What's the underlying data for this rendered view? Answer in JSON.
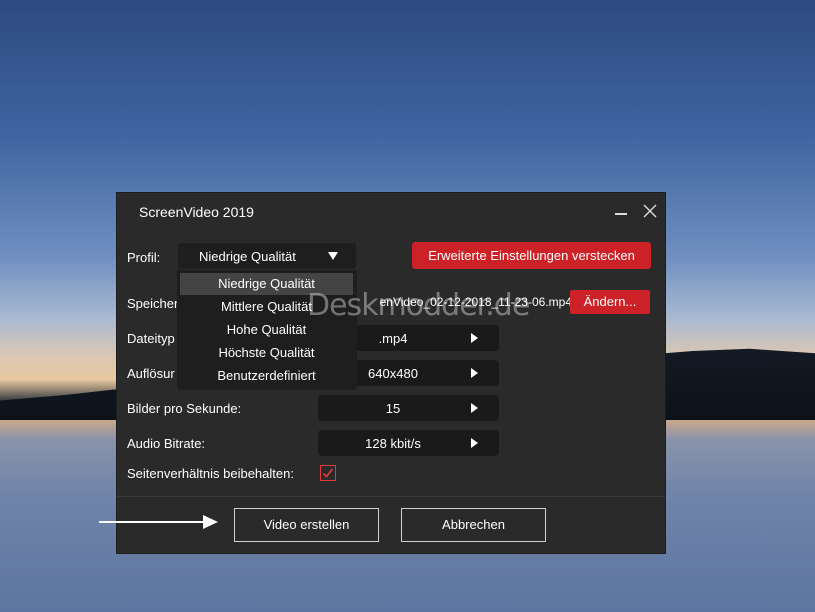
{
  "window": {
    "title": "ScreenVideo 2019"
  },
  "profile": {
    "label": "Profil:",
    "value": "Niedrige Qualität"
  },
  "advanced_button": "Erweiterte Einstellungen verstecken",
  "save": {
    "label": "Speicher",
    "path": "enVideo_02-12-2018_11-23-06.mp4",
    "change_button": "Ändern..."
  },
  "filetype": {
    "label": "Dateityp",
    "value": ".mp4"
  },
  "resolution": {
    "label": "Auflösur",
    "value": "640x480"
  },
  "fps": {
    "label": "Bilder pro Sekunde:",
    "value": "15"
  },
  "audio": {
    "label": "Audio Bitrate:",
    "value": "128 kbit/s"
  },
  "aspect": {
    "label": "Seitenverhältnis beibehalten:",
    "checked": true
  },
  "buttons": {
    "create": "Video erstellen",
    "cancel": "Abbrechen"
  },
  "dropdown": {
    "options": [
      "Niedrige Qualität",
      "Mittlere Qualität",
      "Hohe Qualität",
      "Höchste Qualität",
      "Benutzerdefiniert"
    ],
    "selected_index": 0
  },
  "watermark": "Deskmodder.de",
  "colors": {
    "accent_red": "#cc2127",
    "window_bg": "#2a2a2a"
  }
}
